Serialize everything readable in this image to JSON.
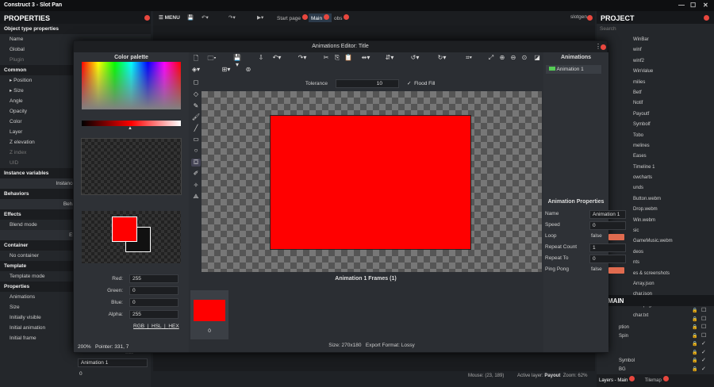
{
  "app": {
    "title": "Construct 3 - Slot Pan"
  },
  "properties": {
    "header": "PROPERTIES",
    "rows": [
      {
        "t": "Object type properties",
        "sec": true
      },
      {
        "t": "Name"
      },
      {
        "t": "Global"
      },
      {
        "t": "Plugin",
        "dim": true
      },
      {
        "t": "Common",
        "sec": true
      },
      {
        "t": "▸ Position"
      },
      {
        "t": "▸ Size"
      },
      {
        "t": "Angle"
      },
      {
        "t": "Opacity"
      },
      {
        "t": "Color"
      },
      {
        "t": "Layer"
      },
      {
        "t": "Z elevation"
      },
      {
        "t": "Z index",
        "dim": true
      },
      {
        "t": "UID",
        "dim": true
      },
      {
        "t": "Instance variables",
        "sec": true
      },
      {
        "t": "Instance",
        "c": true
      },
      {
        "t": "Behaviors",
        "sec": true
      },
      {
        "t": "Beha",
        "c": true
      },
      {
        "t": "Effects",
        "sec": true
      },
      {
        "t": "Blend mode"
      },
      {
        "t": "Eff",
        "c": true
      },
      {
        "t": "Container",
        "sec": true
      },
      {
        "t": "No container"
      },
      {
        "t": "Template",
        "sec": true
      },
      {
        "t": "Template mode"
      },
      {
        "t": "Properties",
        "sec": true
      },
      {
        "t": "Animations"
      },
      {
        "t": "Size"
      },
      {
        "t": "Initially visible"
      },
      {
        "t": "Initial animation"
      },
      {
        "t": "Initial frame"
      }
    ],
    "initial_animation": "Animation 1",
    "initial_frame": "0",
    "true_label": "true"
  },
  "toolbar": {
    "menu": "MENU",
    "tabs": [
      "Start page",
      "Main",
      "obs"
    ],
    "user": "slotgen"
  },
  "project": {
    "header": "PROJECT",
    "search_placeholder": "Search",
    "items": [
      "WinBar",
      "winf",
      "winf2",
      "WinValue",
      "milies",
      "Betf",
      "Notif",
      "Payoutf",
      "Symbolf",
      "Tobo",
      "melines",
      "Eases",
      "Timeline 1",
      "owcharts",
      "unds",
      "Button.webm",
      "Drop.webm",
      "Win.webm",
      "sic",
      "GameMusic.webm",
      "deos",
      "nts",
      "es & screenshots",
      "Array.json",
      "char.json",
      "char.png",
      "char.txt"
    ],
    "layers_header": "MAIN",
    "layers": [
      "",
      "",
      "ption",
      "Spin",
      "",
      "",
      "Symbol",
      "BG"
    ],
    "bottom_tabs": [
      "Layers - Main",
      "Tilemap"
    ]
  },
  "editor": {
    "title": "Animations Editor: Title",
    "color_palette": "Color palette",
    "tolerance_label": "Tolerance",
    "tolerance": "10",
    "flood_fill": "Flood Fill",
    "red_label": "Red:",
    "red": "255",
    "green_label": "Green:",
    "green": "0",
    "blue_label": "Blue:",
    "blue": "0",
    "alpha_label": "Alpha:",
    "alpha": "255",
    "modes": [
      "RGB",
      "HSL",
      "HEX"
    ],
    "zoom": "200%",
    "pointer": "Pointer: 331, 7",
    "size": "Size: 270x180",
    "export": "Export Format: Lossy",
    "frames_header": "Animation 1 Frames (1)",
    "frame_index": "0",
    "animations_header": "Animations",
    "animation": "Animation 1",
    "props_header": "Animation Properties",
    "props": [
      {
        "k": "Name",
        "v": "Animation 1"
      },
      {
        "k": "Speed",
        "v": "0"
      },
      {
        "k": "Loop",
        "v": "false"
      },
      {
        "k": "Repeat Count",
        "v": "1"
      },
      {
        "k": "Repeat To",
        "v": "0"
      },
      {
        "k": "Ping Pong",
        "v": "false"
      }
    ],
    "fill_color": "#ff0000"
  },
  "status": {
    "mouse": "Mouse: (23, 189)",
    "layer_label": "Active layer:",
    "layer": "Payout",
    "zoom": "Zoom: 62%"
  }
}
